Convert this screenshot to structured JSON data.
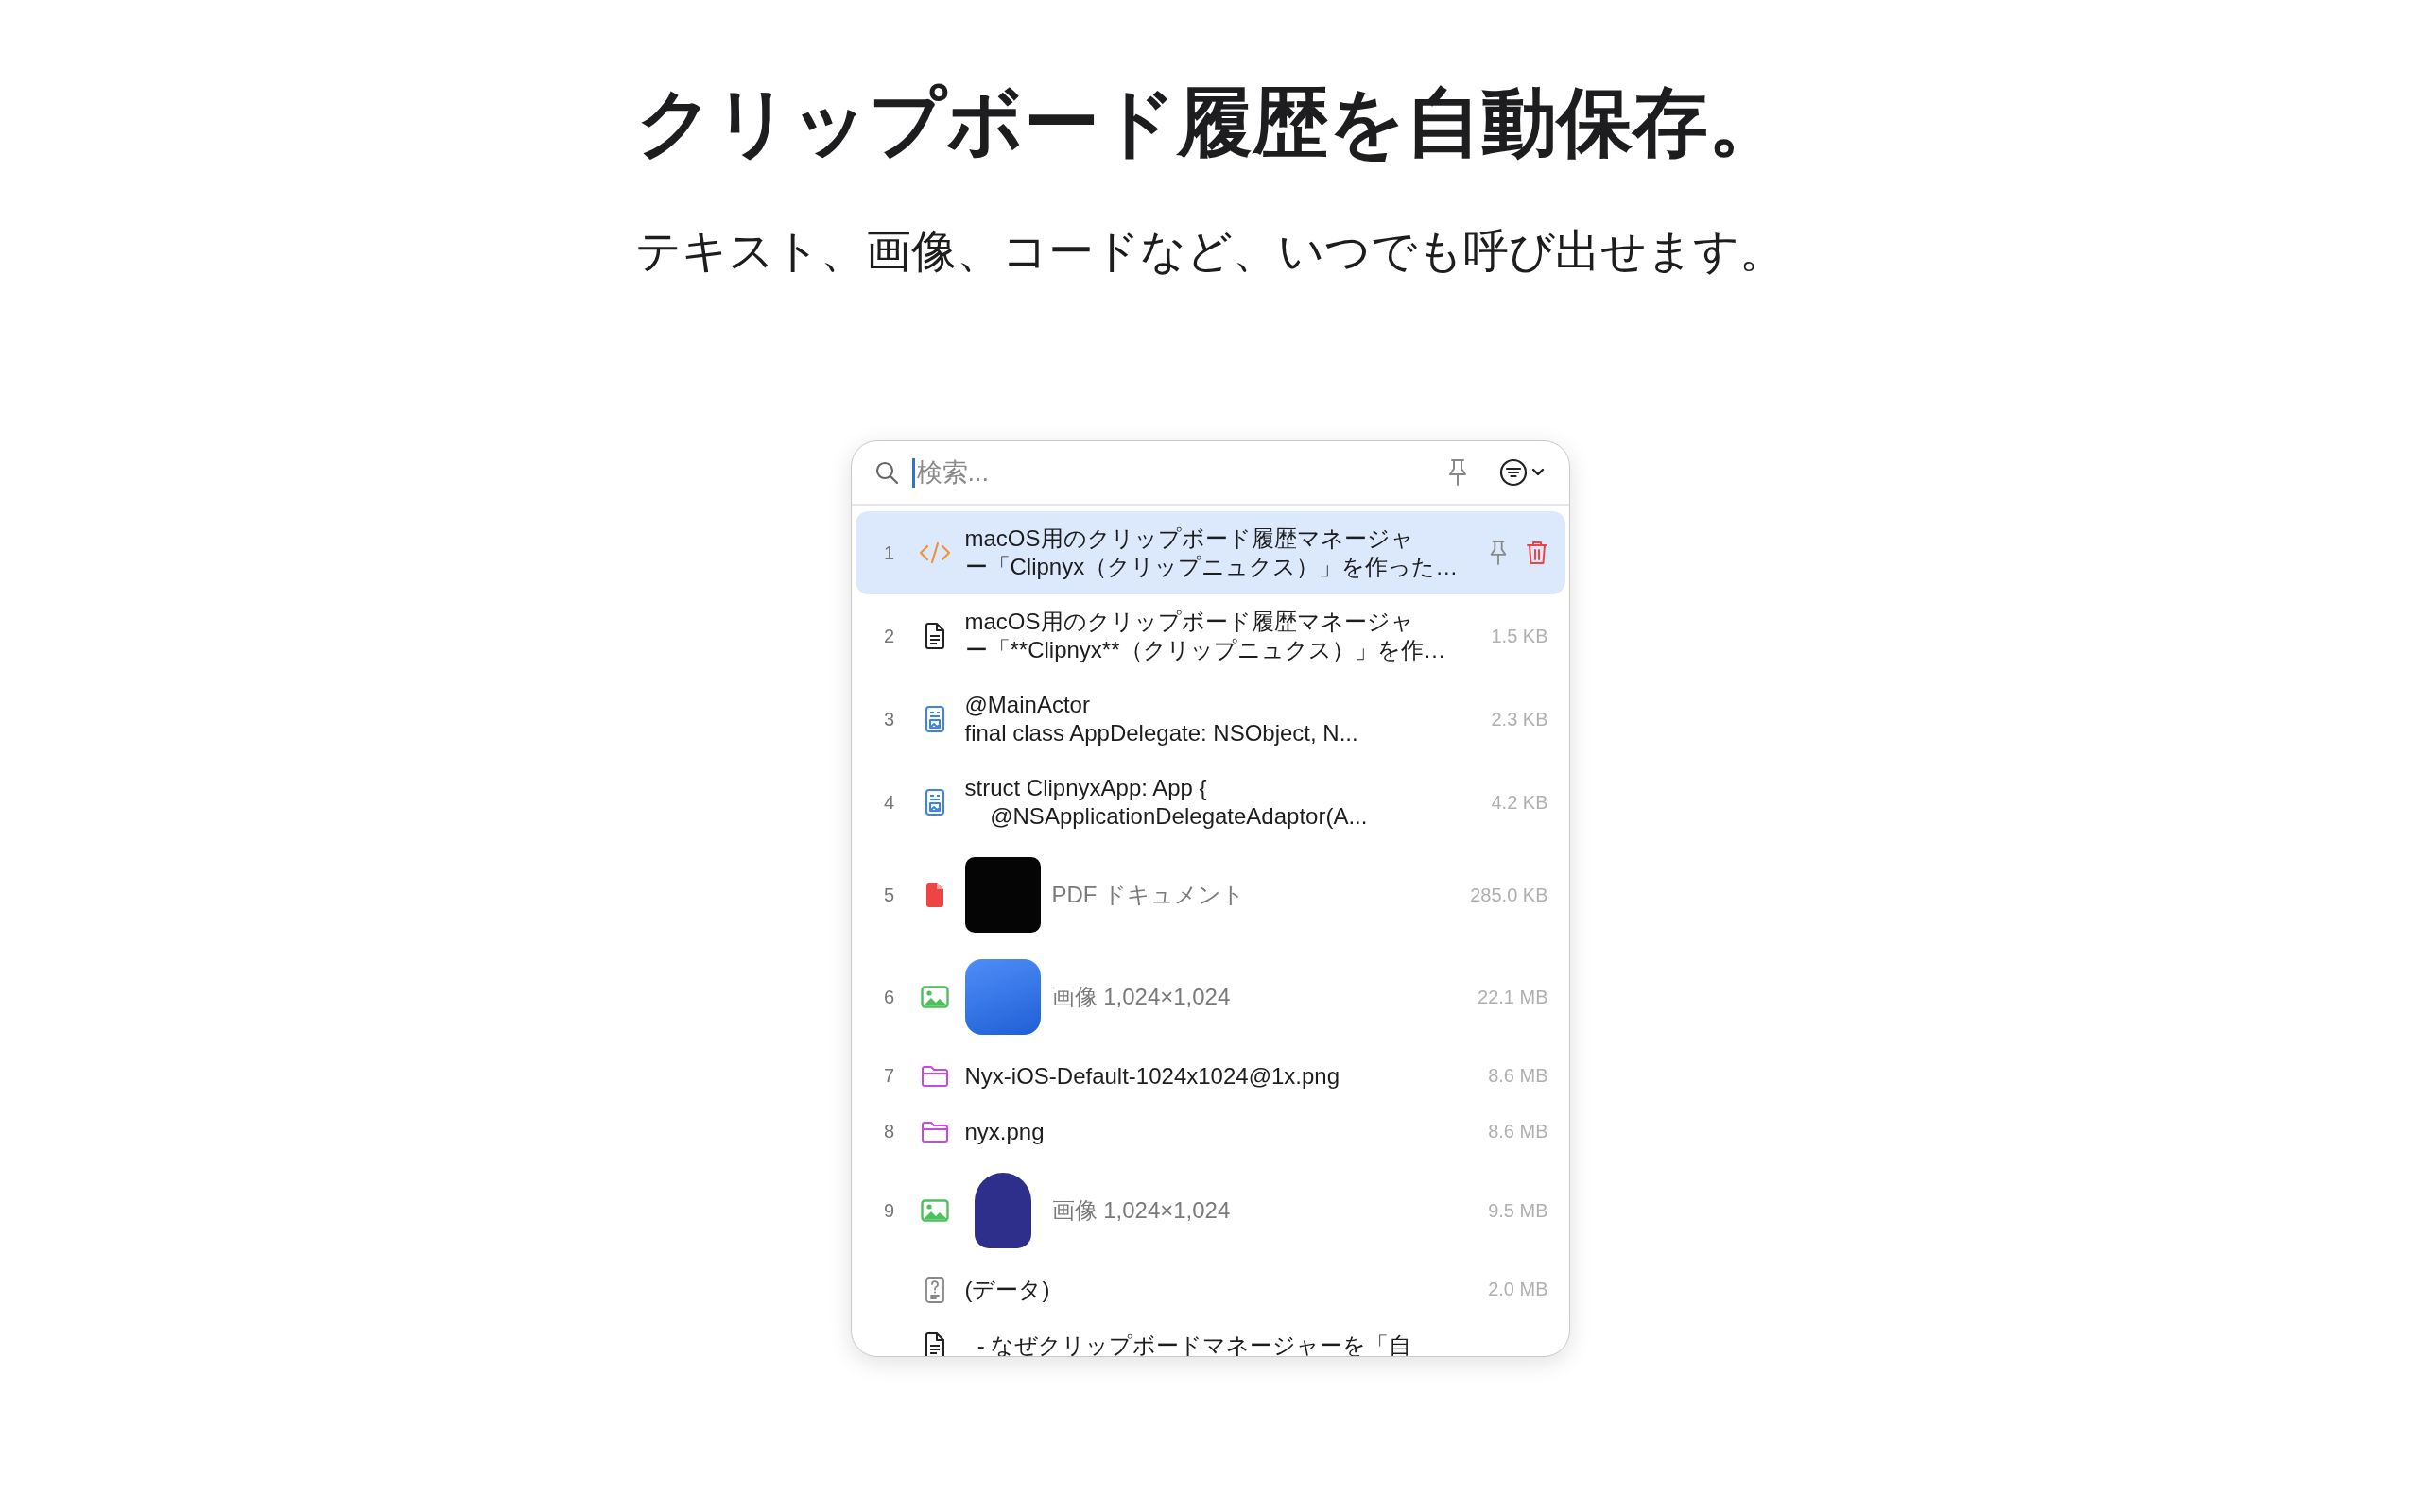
{
  "heading": {
    "title": "クリップボード履歴を自動保存。",
    "subtitle": "テキスト、画像、コードなど、いつでも呼び出せます。"
  },
  "search": {
    "placeholder": "検索..."
  },
  "items": [
    {
      "index": "1",
      "kind": "code",
      "lines": [
        "macOS用のクリップボード履歴マネージャ",
        "ー「Clipnyx（クリップニュクス）」を作った…"
      ],
      "muted": false,
      "selected": true
    },
    {
      "index": "2",
      "kind": "text",
      "lines": [
        "macOS用のクリップボード履歴マネージャ",
        "ー「**Clipnyx**（クリップニュクス）」を作…"
      ],
      "size": "1.5 KB",
      "muted": false,
      "selected": false
    },
    {
      "index": "3",
      "kind": "rich",
      "lines": [
        "@MainActor",
        "final class AppDelegate: NSObject, N..."
      ],
      "size": "2.3 KB",
      "muted": false,
      "selected": false
    },
    {
      "index": "4",
      "kind": "rich",
      "lines": [
        "struct ClipnyxApp: App {",
        "    @NSApplicationDelegateAdaptor(A..."
      ],
      "size": "4.2 KB",
      "muted": false,
      "selected": false
    },
    {
      "index": "5",
      "kind": "pdf",
      "thumbnail": {
        "kind": "dark"
      },
      "lines": [
        "PDF ドキュメント"
      ],
      "size": "285.0 KB",
      "muted": true,
      "selected": false
    },
    {
      "index": "6",
      "kind": "image",
      "thumbnail": {
        "kind": "blue"
      },
      "lines": [
        "画像 1,024×1,024"
      ],
      "size": "22.1 MB",
      "muted": true,
      "selected": false
    },
    {
      "index": "7",
      "kind": "file",
      "lines": [
        "Nyx-iOS-Default-1024x1024@1x.png"
      ],
      "size": "8.6 MB",
      "muted": false,
      "selected": false
    },
    {
      "index": "8",
      "kind": "file",
      "lines": [
        "nyx.png"
      ],
      "size": "8.6 MB",
      "muted": false,
      "selected": false
    },
    {
      "index": "9",
      "kind": "image",
      "thumbnail": {
        "kind": "plain"
      },
      "lines": [
        "画像 1,024×1,024"
      ],
      "size": "9.5 MB",
      "muted": true,
      "selected": false
    },
    {
      "kind": "unknown",
      "lines": [
        "(データ)"
      ],
      "size": "2.0 MB",
      "muted": false,
      "selected": false
    },
    {
      "kind": "text",
      "lines": [
        "  - なぜクリップボードマネージャーを「自"
      ],
      "muted": false,
      "selected": false
    }
  ]
}
